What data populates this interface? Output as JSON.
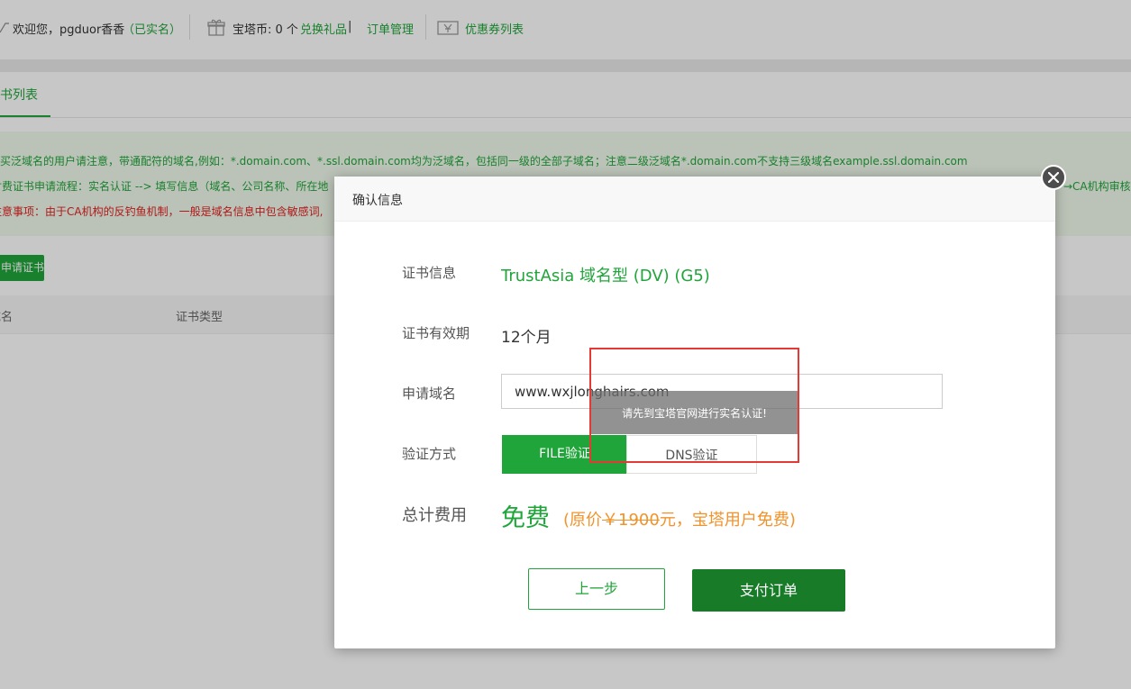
{
  "header": {
    "welcome": "欢迎您，pgduor香香",
    "verified": "（已实名）",
    "coins_label": "宝塔币: 0 个",
    "redeem_link": "兑换礼品",
    "pipe": "|",
    "orders_link": "订单管理",
    "coupons_link": "优惠券列表"
  },
  "tabs": {
    "active": "证书列表"
  },
  "notice": {
    "line1": "购买泛域名的用户请注意，带通配符的域名,例如：*.domain.com、*.ssl.domain.com均为泛域名，包括同一级的全部子域名；注意二级泛域名*.domain.com不支持三级域名example.ssl.domain.com",
    "line2": "付费证书申请流程：实名认证 --> 填写信息（域名、公司名称、所在地",
    "line2_tail": "→CA机构审核",
    "line3": "注意事项：由于CA机构的反钓鱼机制，一般是域名信息中包含敏感词,"
  },
  "apply_button": "申请证书",
  "table": {
    "col_domain": "域名",
    "col_type": "证书类型"
  },
  "dialog": {
    "title": "确认信息",
    "cert_info_label": "证书信息",
    "cert_info_value": "TrustAsia 域名型 (DV) (G5)",
    "validity_label": "证书有效期",
    "validity_value": "12个月",
    "domain_label": "申请域名",
    "domain_value": "www.wxjlonghairs.com",
    "verify_label": "验证方式",
    "verify_file": "FILE验证",
    "verify_dns": "DNS验证",
    "total_label": "总计费用",
    "total_free": "免费",
    "orig_prefix": "(原价",
    "orig_price": "￥1900",
    "orig_suffix": "元，宝塔用户免费)",
    "btn_prev": "上一步",
    "btn_pay": "支付订单"
  },
  "toast": "请先到宝塔官网进行实名认证!",
  "colors": {
    "accent": "#20a53a",
    "accent_dark": "#177b28",
    "warn": "#f0932b",
    "danger": "#e53935"
  }
}
